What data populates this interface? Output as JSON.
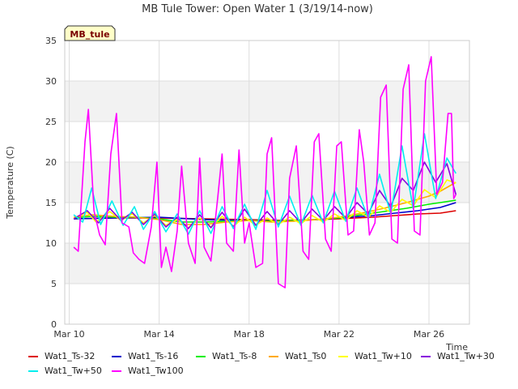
{
  "chart_data": {
    "type": "line",
    "title": "MB Tule Tower: Open Water 1 (3/19/14-now)",
    "site_label": "MB_tule",
    "xlabel": "Time",
    "ylabel": "Temperature (C)",
    "ylim": [
      0,
      35
    ],
    "yticks": [
      0,
      5,
      10,
      15,
      20,
      25,
      30,
      35
    ],
    "xlim": [
      9.8,
      27.8
    ],
    "xticks": [
      {
        "value": 10,
        "label": "Mar 10"
      },
      {
        "value": 14,
        "label": "Mar 14"
      },
      {
        "value": 18,
        "label": "Mar 18"
      },
      {
        "value": 22,
        "label": "Mar 22"
      },
      {
        "value": 26,
        "label": "Mar 26"
      }
    ],
    "grid": true,
    "legend_position": "bottom",
    "series": [
      {
        "name": "Wat1_Ts-32",
        "color": "#dd0000",
        "x": [
          10.2,
          12,
          14,
          16,
          18,
          19.5,
          21,
          22,
          23.5,
          24.5,
          25.5,
          26.5,
          27.2
        ],
        "y": [
          13.0,
          13.1,
          13.1,
          13.0,
          12.9,
          12.8,
          12.9,
          13.0,
          13.2,
          13.4,
          13.6,
          13.7,
          14.0
        ]
      },
      {
        "name": "Wat1_Ts-16",
        "color": "#0000cc",
        "x": [
          10.2,
          12,
          14,
          16,
          18,
          19.5,
          21,
          22,
          23.5,
          24.5,
          25.5,
          26.5,
          27.2
        ],
        "y": [
          13.0,
          13.1,
          13.2,
          12.9,
          12.8,
          12.7,
          12.9,
          13.1,
          13.4,
          13.7,
          14.0,
          14.4,
          15.0
        ]
      },
      {
        "name": "Wat1_Ts-8",
        "color": "#00ee00",
        "x": [
          10.2,
          11,
          12,
          13,
          14,
          15,
          16,
          17,
          18,
          19,
          20,
          21,
          22,
          23,
          24,
          25,
          26,
          26.5,
          27.2
        ],
        "y": [
          13.1,
          13.3,
          13.2,
          13.2,
          13.0,
          12.6,
          12.6,
          12.7,
          12.8,
          12.7,
          12.8,
          12.9,
          13.1,
          13.5,
          13.9,
          14.3,
          14.8,
          15.0,
          15.3
        ]
      },
      {
        "name": "Wat1_Ts0",
        "color": "#ffaa00",
        "x": [
          10.2,
          11,
          12,
          13,
          14,
          15,
          16,
          17,
          18,
          19,
          20,
          21,
          22,
          23,
          24,
          25,
          26,
          26.5,
          27.2
        ],
        "y": [
          13.2,
          13.5,
          13.3,
          13.2,
          12.9,
          12.3,
          12.3,
          12.6,
          12.8,
          12.6,
          12.7,
          12.9,
          13.2,
          13.7,
          14.3,
          15.0,
          15.8,
          16.4,
          17.5
        ]
      },
      {
        "name": "Wat1_Tw+10",
        "color": "#ffff00",
        "x": [
          10.2,
          10.8,
          11.2,
          11.8,
          12.3,
          12.8,
          13.3,
          13.8,
          14.3,
          14.8,
          15.3,
          15.8,
          16.3,
          16.8,
          17.3,
          17.8,
          18.3,
          18.8,
          19.3,
          19.8,
          20.3,
          20.8,
          21.3,
          21.8,
          22.3,
          22.8,
          23.3,
          23.8,
          24.3,
          24.8,
          25.3,
          25.8,
          26.3,
          26.8,
          27.2
        ],
        "y": [
          13.1,
          13.8,
          12.6,
          13.9,
          12.8,
          13.6,
          12.5,
          13.4,
          12.2,
          12.9,
          11.9,
          13.1,
          12.0,
          13.3,
          12.1,
          13.2,
          12.2,
          13.1,
          12.3,
          13.2,
          12.4,
          13.4,
          12.6,
          13.6,
          12.8,
          14.0,
          13.2,
          14.6,
          13.8,
          15.4,
          14.6,
          16.6,
          15.6,
          17.8,
          17.4
        ]
      },
      {
        "name": "Wat1_Tw+30",
        "color": "#8800dd",
        "x": [
          10.2,
          10.8,
          11.3,
          11.8,
          12.3,
          12.8,
          13.3,
          13.8,
          14.3,
          14.8,
          15.3,
          15.8,
          16.3,
          16.8,
          17.3,
          17.8,
          18.3,
          18.8,
          19.3,
          19.8,
          20.3,
          20.8,
          21.3,
          21.8,
          22.3,
          22.8,
          23.3,
          23.8,
          24.3,
          24.8,
          25.3,
          25.8,
          26.3,
          26.8,
          27.2
        ],
        "y": [
          13.0,
          14.0,
          12.5,
          14.3,
          12.8,
          13.8,
          12.3,
          13.6,
          12.0,
          13.2,
          11.8,
          13.5,
          11.9,
          13.8,
          12.0,
          14.2,
          12.2,
          13.9,
          12.3,
          14.0,
          12.5,
          14.2,
          12.8,
          14.5,
          13.1,
          15.0,
          13.6,
          16.5,
          14.5,
          18.0,
          16.5,
          20.0,
          17.5,
          19.8,
          16.0
        ]
      },
      {
        "name": "Wat1_Tw+50",
        "color": "#00eeee",
        "x": [
          10.2,
          10.6,
          11.0,
          11.4,
          11.9,
          12.4,
          12.9,
          13.3,
          13.8,
          14.3,
          14.8,
          15.3,
          15.8,
          16.3,
          16.8,
          17.3,
          17.8,
          18.3,
          18.8,
          19.3,
          19.8,
          20.3,
          20.8,
          21.3,
          21.8,
          22.3,
          22.8,
          23.3,
          23.8,
          24.3,
          24.8,
          25.3,
          25.8,
          26.3,
          26.8,
          27.2
        ],
        "y": [
          13.5,
          12.6,
          16.8,
          12.3,
          15.2,
          12.2,
          14.5,
          11.7,
          13.9,
          11.4,
          13.6,
          11.1,
          14.0,
          11.2,
          14.5,
          11.8,
          14.8,
          11.7,
          16.5,
          12.0,
          15.8,
          12.2,
          15.9,
          12.5,
          16.4,
          12.7,
          16.8,
          13.0,
          18.5,
          13.6,
          22.0,
          14.2,
          23.5,
          15.5,
          20.5,
          18.6
        ]
      },
      {
        "name": "Wat1_Tw100",
        "color": "#ff00ff",
        "x": [
          10.2,
          10.4,
          10.7,
          10.85,
          11.1,
          11.35,
          11.6,
          11.85,
          12.1,
          12.35,
          12.65,
          12.85,
          13.1,
          13.35,
          13.65,
          13.9,
          14.1,
          14.3,
          14.55,
          14.8,
          15.0,
          15.3,
          15.6,
          15.8,
          16.0,
          16.3,
          16.6,
          16.8,
          17.0,
          17.3,
          17.55,
          17.8,
          18.0,
          18.3,
          18.6,
          18.8,
          19.0,
          19.3,
          19.6,
          19.8,
          20.1,
          20.4,
          20.65,
          20.9,
          21.1,
          21.4,
          21.65,
          21.9,
          22.1,
          22.4,
          22.65,
          22.9,
          23.1,
          23.35,
          23.6,
          23.85,
          24.1,
          24.35,
          24.6,
          24.85,
          25.1,
          25.35,
          25.6,
          25.85,
          26.1,
          26.35,
          26.6,
          26.85,
          27.0,
          27.1,
          27.2
        ],
        "y": [
          9.5,
          9.0,
          22.5,
          26.5,
          14.0,
          11.0,
          9.8,
          21.0,
          26.0,
          12.5,
          12.0,
          8.8,
          8.0,
          7.5,
          12.0,
          20.0,
          7.0,
          9.5,
          6.5,
          11.5,
          19.5,
          10.0,
          7.5,
          20.5,
          9.5,
          7.8,
          15.5,
          21.0,
          10.0,
          9.0,
          21.5,
          10.0,
          12.5,
          7.0,
          7.5,
          21.0,
          23.0,
          5.0,
          4.5,
          18.0,
          22.0,
          9.0,
          8.0,
          22.5,
          23.5,
          10.5,
          9.0,
          22.0,
          22.5,
          11.0,
          11.5,
          24.0,
          20.0,
          11.0,
          12.5,
          28.0,
          29.5,
          10.5,
          10.0,
          29.0,
          32.0,
          11.5,
          11.0,
          30.0,
          33.0,
          16.0,
          17.5,
          26.0,
          26.0,
          15.5,
          16.0
        ]
      }
    ]
  }
}
